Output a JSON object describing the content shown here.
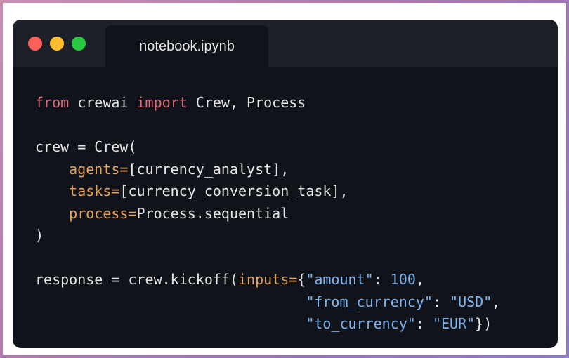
{
  "window": {
    "tab_title": "notebook.ipynb",
    "controls": [
      "close-button",
      "minimize-button",
      "maximize-button"
    ]
  },
  "code": {
    "lines": [
      [
        {
          "t": "from",
          "c": "kw"
        },
        {
          "t": " crewai ",
          "c": "plain"
        },
        {
          "t": "import",
          "c": "kw"
        },
        {
          "t": " Crew, Process",
          "c": "plain"
        }
      ],
      [],
      [
        {
          "t": "crew = Crew(",
          "c": "plain"
        }
      ],
      [
        {
          "t": "    ",
          "c": "plain"
        },
        {
          "t": "agents=",
          "c": "param"
        },
        {
          "t": "[currency_analyst],",
          "c": "plain"
        }
      ],
      [
        {
          "t": "    ",
          "c": "plain"
        },
        {
          "t": "tasks=",
          "c": "param"
        },
        {
          "t": "[currency_conversion_task],",
          "c": "plain"
        }
      ],
      [
        {
          "t": "    ",
          "c": "plain"
        },
        {
          "t": "process=",
          "c": "param"
        },
        {
          "t": "Process.sequential",
          "c": "plain"
        }
      ],
      [
        {
          "t": ")",
          "c": "plain"
        }
      ],
      [],
      [
        {
          "t": "response = crew.kickoff(",
          "c": "plain"
        },
        {
          "t": "inputs=",
          "c": "param"
        },
        {
          "t": "{",
          "c": "plain"
        },
        {
          "t": "\"amount\"",
          "c": "str"
        },
        {
          "t": ": ",
          "c": "plain"
        },
        {
          "t": "100",
          "c": "num"
        },
        {
          "t": ",",
          "c": "plain"
        }
      ],
      [
        {
          "t": "                                ",
          "c": "plain"
        },
        {
          "t": "\"from_currency\"",
          "c": "str"
        },
        {
          "t": ": ",
          "c": "plain"
        },
        {
          "t": "\"USD\"",
          "c": "str"
        },
        {
          "t": ",",
          "c": "plain"
        }
      ],
      [
        {
          "t": "                                ",
          "c": "plain"
        },
        {
          "t": "\"to_currency\"",
          "c": "str"
        },
        {
          "t": ": ",
          "c": "plain"
        },
        {
          "t": "\"EUR\"",
          "c": "str"
        },
        {
          "t": "})",
          "c": "plain"
        }
      ]
    ]
  },
  "colors": {
    "keyword": "#e26b7a",
    "parameter": "#e6a257",
    "string": "#7db5f0",
    "text": "#e6e6e6",
    "background": "#11131a"
  }
}
